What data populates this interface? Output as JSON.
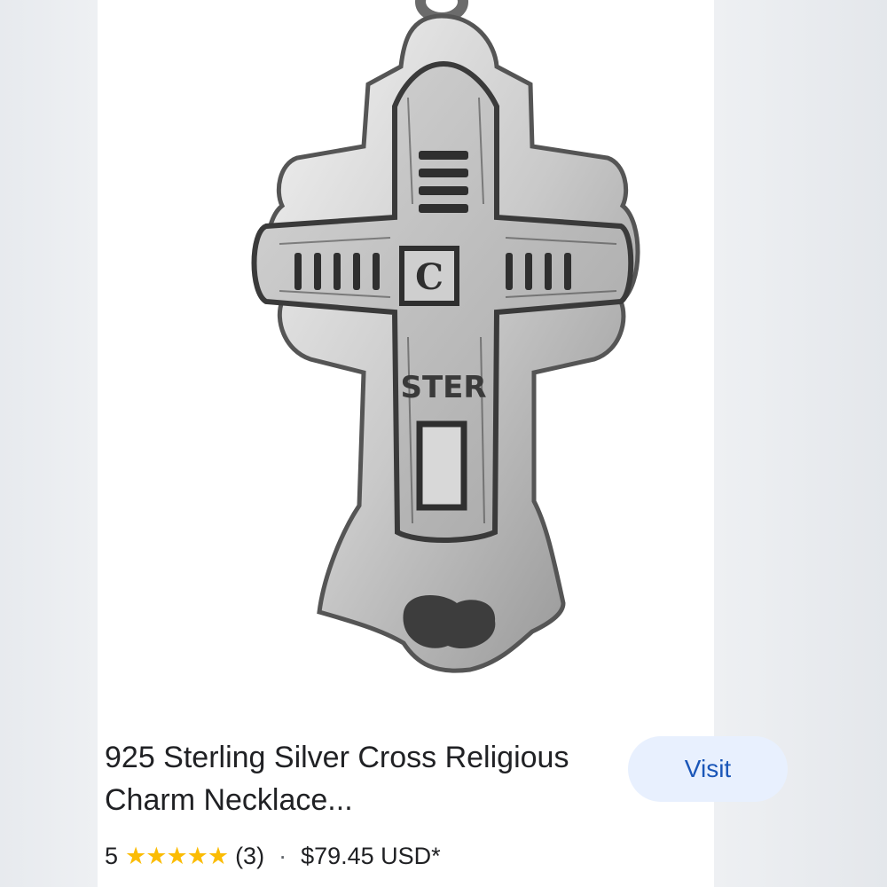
{
  "product": {
    "title": "925 Sterling Silver Cross Religious Charm Necklace...",
    "visit_label": "Visit",
    "rating": "5",
    "stars": "★★★★★",
    "review_count": "(3)",
    "separator": "·",
    "price": "$79.45 USD*"
  },
  "pendant_engraving": {
    "center_letter": "C",
    "stamp": "STER"
  },
  "colors": {
    "button_bg": "#e8f0fe",
    "button_text": "#1a56b8",
    "star": "#fbbc04"
  }
}
